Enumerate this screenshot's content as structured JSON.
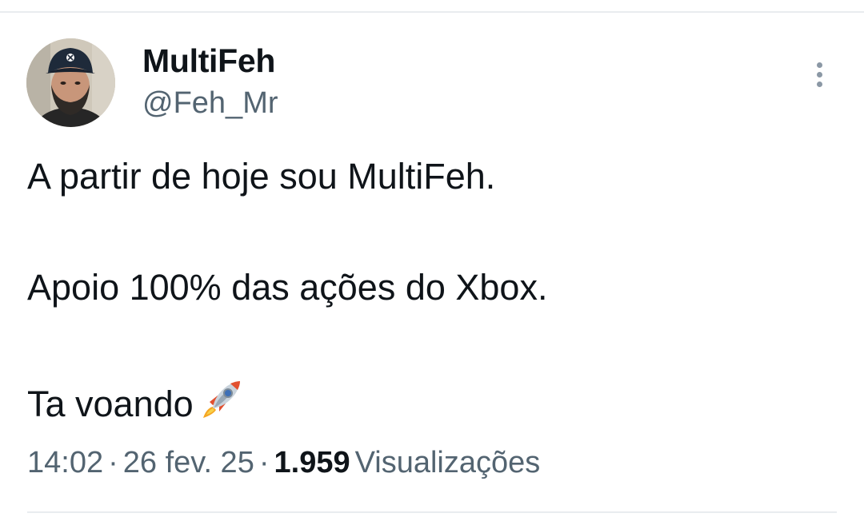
{
  "author": {
    "display_name": "MultiFeh",
    "handle": "@Feh_Mr"
  },
  "tweet": {
    "lines": [
      "A partir de hoje sou MultiFeh.",
      "Apoio 100% das ações do Xbox.",
      "Ta voando"
    ],
    "emoji_icon": "rocket-icon"
  },
  "meta": {
    "time": "14:02",
    "separator": "·",
    "date": "26 fev. 25",
    "views_count": "1.959",
    "views_label": "Visualizações"
  },
  "colors": {
    "primary_text": "#0f1419",
    "secondary_text": "#536471",
    "divider": "#e9ecef"
  }
}
